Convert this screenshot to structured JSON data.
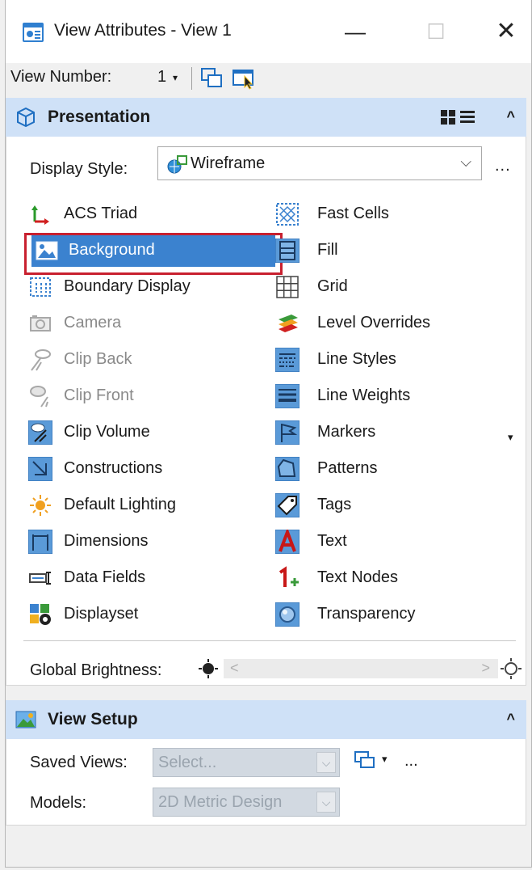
{
  "window": {
    "title": "View Attributes - View 1",
    "minimize": "—",
    "maximize": "☐",
    "close": "✕"
  },
  "toolbar": {
    "view_number_label": "View Number:",
    "view_number_value": "1",
    "view_number_arrow": "▾"
  },
  "presentation": {
    "title": "Presentation",
    "collapse": "^",
    "display_style_label": "Display Style:",
    "display_style_value": "Wireframe",
    "display_style_arrow": "⌵",
    "display_style_more": "...",
    "attributes_left": [
      {
        "label": "ACS Triad",
        "icon": "acs-triad-icon",
        "disabled": false
      },
      {
        "label": "Background",
        "icon": "background-icon",
        "selected": true
      },
      {
        "label": "Boundary Display",
        "icon": "boundary-display-icon"
      },
      {
        "label": "Camera",
        "icon": "camera-icon",
        "disabled": true
      },
      {
        "label": "Clip Back",
        "icon": "clip-back-icon",
        "disabled": true
      },
      {
        "label": "Clip Front",
        "icon": "clip-front-icon",
        "disabled": true
      },
      {
        "label": "Clip Volume",
        "icon": "clip-volume-icon"
      },
      {
        "label": "Constructions",
        "icon": "constructions-icon"
      },
      {
        "label": "Default Lighting",
        "icon": "default-lighting-icon"
      },
      {
        "label": "Dimensions",
        "icon": "dimensions-icon"
      },
      {
        "label": "Data Fields",
        "icon": "data-fields-icon"
      },
      {
        "label": "Displayset",
        "icon": "displayset-icon"
      }
    ],
    "attributes_right": [
      {
        "label": "Fast Cells",
        "icon": "fast-cells-icon"
      },
      {
        "label": "Fill",
        "icon": "fill-icon"
      },
      {
        "label": "Grid",
        "icon": "grid-icon"
      },
      {
        "label": "Level Overrides",
        "icon": "level-overrides-icon"
      },
      {
        "label": "Line Styles",
        "icon": "line-styles-icon"
      },
      {
        "label": "Line Weights",
        "icon": "line-weights-icon"
      },
      {
        "label": "Markers",
        "icon": "markers-icon"
      },
      {
        "label": "Patterns",
        "icon": "patterns-icon"
      },
      {
        "label": "Tags",
        "icon": "tags-icon"
      },
      {
        "label": "Text",
        "icon": "text-icon"
      },
      {
        "label": "Text Nodes",
        "icon": "text-nodes-icon"
      },
      {
        "label": "Transparency",
        "icon": "transparency-icon"
      }
    ],
    "markers_dropdown": "▾",
    "global_brightness_label": "Global Brightness:",
    "slider_left": "<",
    "slider_right": ">"
  },
  "view_setup": {
    "title": "View Setup",
    "collapse": "^",
    "saved_views_label": "Saved Views:",
    "saved_views_value": "Select...",
    "saved_views_arrow": "⌵",
    "saved_views_more": "...",
    "saved_views_dropdown": "▾",
    "models_label": "Models:",
    "models_value": "2D Metric Design",
    "models_arrow": "⌵"
  },
  "colors": {
    "section_header": "#cfe1f7",
    "selection": "#3b82cf",
    "highlight_box": "#c8202f"
  }
}
